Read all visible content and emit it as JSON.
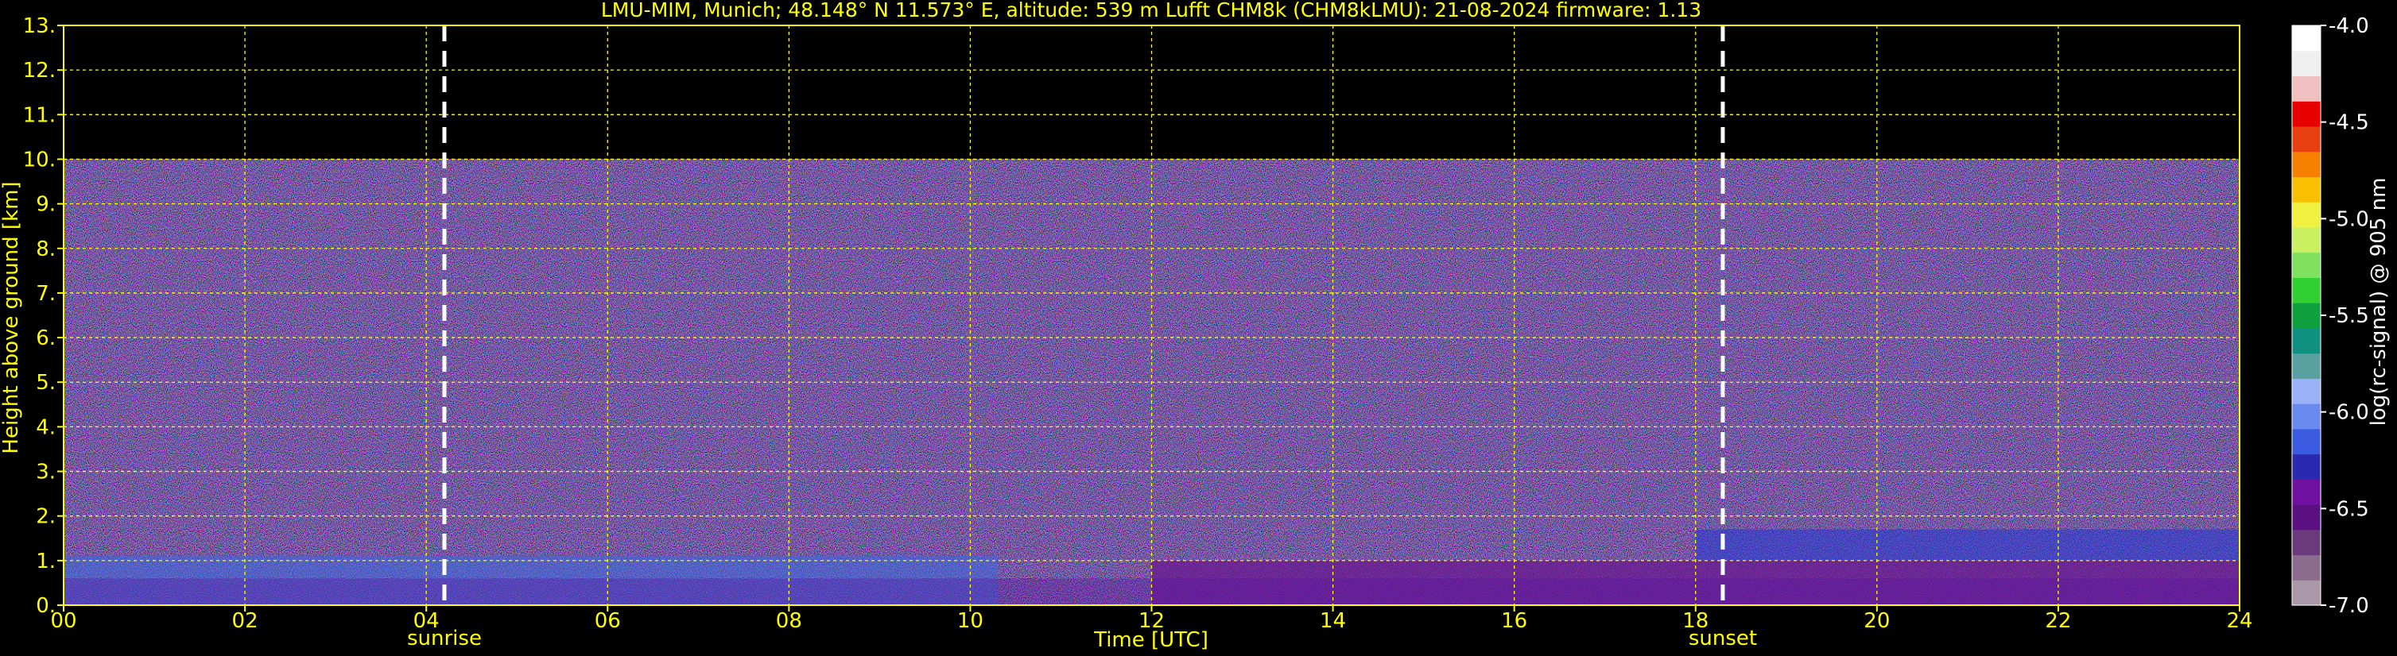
{
  "chart_data": {
    "type": "heatmap",
    "title": "LMU-MIM, Munich; 48.148° N 11.573° E, altitude: 539 m    Lufft CHM8k (CHM8kLMU): 21-08-2024    firmware: 1.13",
    "xlabel": "Time [UTC]",
    "ylabel": "Height above ground [km]",
    "colorbar_label": "log(rc-signal) @ 905 nm",
    "x_range": [
      0,
      24
    ],
    "y_range": [
      0,
      13
    ],
    "x_ticks": [
      "00",
      "02",
      "04",
      "06",
      "08",
      "10",
      "12",
      "14",
      "16",
      "18",
      "20",
      "22",
      "24"
    ],
    "y_ticks": [
      "0.",
      "1.",
      "2.",
      "3.",
      "4.",
      "5.",
      "6.",
      "7.",
      "8.",
      "9.",
      "10.",
      "11.",
      "12.",
      "13."
    ],
    "colorbar_ticks": [
      "-4.0",
      "-4.5",
      "-5.0",
      "-5.5",
      "-6.0",
      "-6.5",
      "-7.0"
    ],
    "colorbar_range": [
      -7.0,
      -4.0
    ],
    "grid": true,
    "data_top_km": 10,
    "annotations": [
      {
        "label": "sunrise",
        "time": 4.2
      },
      {
        "label": "sunset",
        "time": 18.3
      }
    ],
    "colorscale": [
      "#a898a8",
      "#8c6c8c",
      "#6a3a7a",
      "#5a1080",
      "#7010a0",
      "#2a2ab0",
      "#3a5ae0",
      "#6a8af0",
      "#9ab0f8",
      "#5aa0a0",
      "#109080",
      "#10a040",
      "#30d030",
      "#80e060",
      "#c8f060",
      "#f0f040",
      "#f8c000",
      "#f88000",
      "#e84010",
      "#e80000",
      "#f0c0c0",
      "#f0f0f0",
      "#ffffff"
    ],
    "colors": {
      "axis": "#ffff00",
      "grid": "#ffff00",
      "background": "#000000"
    }
  }
}
